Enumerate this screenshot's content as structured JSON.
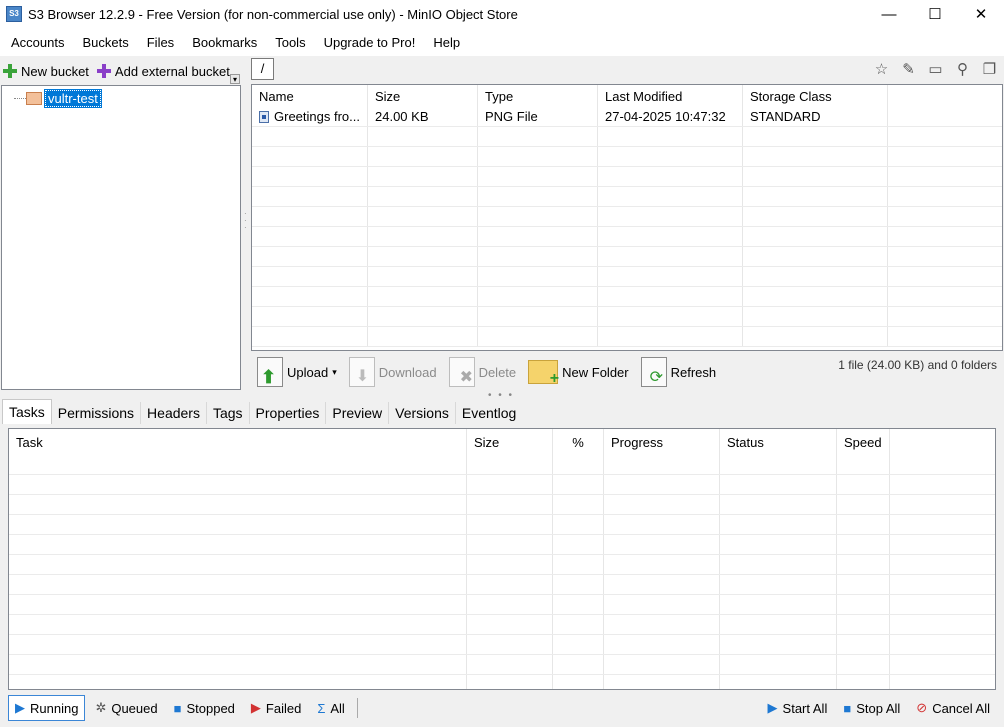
{
  "window": {
    "title": "S3 Browser 12.2.9 - Free Version (for non-commercial use only) - MinIO Object Store",
    "app_icon_text": "S3",
    "minimize": "—",
    "maximize": "☐",
    "close": "✕"
  },
  "menu": [
    "Accounts",
    "Buckets",
    "Files",
    "Bookmarks",
    "Tools",
    "Upgrade to Pro!",
    "Help"
  ],
  "left_toolbar": {
    "new_bucket": "New bucket",
    "add_external_bucket": "Add external bucket",
    "dropdown": "▾",
    "new_bucket_color": "#3aa33a",
    "add_external_color": "#8a3fc8"
  },
  "tree": {
    "bucket": "vultr-test"
  },
  "path": "/",
  "path_toolbar_icons": [
    "star-icon",
    "pencil-icon",
    "window-icon",
    "filter-icon",
    "copy-icon"
  ],
  "path_toolbar_glyphs": [
    "☆",
    "✎",
    "▭",
    "⚲",
    "❐"
  ],
  "files": {
    "columns": [
      "Name",
      "Size",
      "Type",
      "Last Modified",
      "Storage Class"
    ],
    "rows": [
      [
        "Greetings fro...",
        "24.00 KB",
        "PNG File",
        "27-04-2025 10:47:32",
        "STANDARD"
      ]
    ]
  },
  "actions": {
    "upload": "Upload",
    "upload_arrow": "▾",
    "download": "Download",
    "delete": "Delete",
    "new_folder": "New Folder",
    "refresh": "Refresh",
    "status": "1 file (24.00 KB) and 0 folders"
  },
  "tabs": [
    "Tasks",
    "Permissions",
    "Headers",
    "Tags",
    "Properties",
    "Preview",
    "Versions",
    "Eventlog"
  ],
  "tasks": {
    "columns": [
      "Task",
      "Size",
      "%",
      "Progress",
      "Status",
      "Speed"
    ]
  },
  "bottom": {
    "running": "Running",
    "queued": "Queued",
    "stopped": "Stopped",
    "failed": "Failed",
    "all": "All",
    "start_all": "Start All",
    "stop_all": "Stop All",
    "cancel_all": "Cancel All"
  },
  "colors": {
    "selection": "#0078d7",
    "window_bg": "#f0f0f0"
  }
}
